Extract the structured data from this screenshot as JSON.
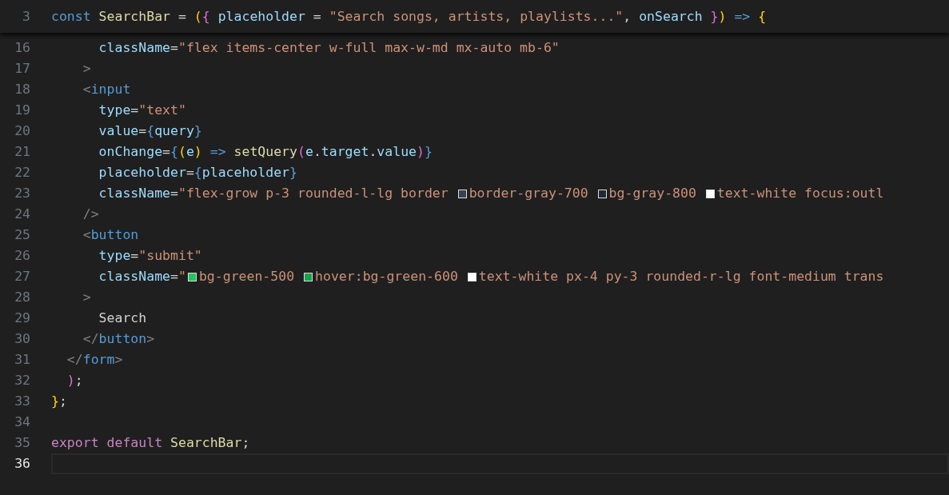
{
  "sticky_line": {
    "number": "3",
    "tokens": [
      {
        "kind": "keyword",
        "text": "const "
      },
      {
        "kind": "function",
        "text": "SearchBar "
      },
      {
        "kind": "punct",
        "text": "= "
      },
      {
        "kind": "bracket1",
        "text": "("
      },
      {
        "kind": "bracket2",
        "text": "{ "
      },
      {
        "kind": "attr",
        "text": "placeholder "
      },
      {
        "kind": "punct",
        "text": "= "
      },
      {
        "kind": "string",
        "text": "\"Search songs, artists, playlists...\""
      },
      {
        "kind": "punct",
        "text": ", "
      },
      {
        "kind": "attr",
        "text": "onSearch "
      },
      {
        "kind": "bracket2",
        "text": "}"
      },
      {
        "kind": "bracket1",
        "text": ")"
      },
      {
        "kind": "keyword",
        "text": " => "
      },
      {
        "kind": "bracket1",
        "text": "{"
      }
    ]
  },
  "lines": [
    {
      "number": "16",
      "current": false,
      "tokens": [
        {
          "kind": "attr",
          "text": "      className"
        },
        {
          "kind": "punct",
          "text": "="
        },
        {
          "kind": "string",
          "text": "\"flex items-center w-full max-w-md mx-auto mb-6\""
        }
      ]
    },
    {
      "number": "17",
      "current": false,
      "tokens": [
        {
          "kind": "tagpunct",
          "text": "    >"
        }
      ]
    },
    {
      "number": "18",
      "current": false,
      "tokens": [
        {
          "kind": "tagpunct",
          "text": "    <"
        },
        {
          "kind": "tag",
          "text": "input"
        }
      ]
    },
    {
      "number": "19",
      "current": false,
      "tokens": [
        {
          "kind": "attr",
          "text": "      type"
        },
        {
          "kind": "punct",
          "text": "="
        },
        {
          "kind": "string",
          "text": "\"text\""
        }
      ]
    },
    {
      "number": "20",
      "current": false,
      "tokens": [
        {
          "kind": "attr",
          "text": "      value"
        },
        {
          "kind": "punct",
          "text": "="
        },
        {
          "kind": "jsx",
          "text": "{"
        },
        {
          "kind": "variable",
          "text": "query"
        },
        {
          "kind": "jsx",
          "text": "}"
        }
      ]
    },
    {
      "number": "21",
      "current": false,
      "tokens": [
        {
          "kind": "attr",
          "text": "      onChange"
        },
        {
          "kind": "punct",
          "text": "="
        },
        {
          "kind": "jsx",
          "text": "{"
        },
        {
          "kind": "bracket1",
          "text": "("
        },
        {
          "kind": "variable",
          "text": "e"
        },
        {
          "kind": "bracket1",
          "text": ")"
        },
        {
          "kind": "keyword",
          "text": " => "
        },
        {
          "kind": "function",
          "text": "setQuery"
        },
        {
          "kind": "bracket2",
          "text": "("
        },
        {
          "kind": "variable",
          "text": "e"
        },
        {
          "kind": "punct",
          "text": "."
        },
        {
          "kind": "variable",
          "text": "target"
        },
        {
          "kind": "punct",
          "text": "."
        },
        {
          "kind": "variable",
          "text": "value"
        },
        {
          "kind": "bracket2",
          "text": ")"
        },
        {
          "kind": "jsx",
          "text": "}"
        }
      ]
    },
    {
      "number": "22",
      "current": false,
      "tokens": [
        {
          "kind": "attr",
          "text": "      placeholder"
        },
        {
          "kind": "punct",
          "text": "="
        },
        {
          "kind": "jsx",
          "text": "{"
        },
        {
          "kind": "variable",
          "text": "placeholder"
        },
        {
          "kind": "jsx",
          "text": "}"
        }
      ]
    },
    {
      "number": "23",
      "current": false,
      "tokens": [
        {
          "kind": "attr",
          "text": "      className"
        },
        {
          "kind": "punct",
          "text": "="
        },
        {
          "kind": "string",
          "text": "\"flex-grow p-3 rounded-l-lg border "
        },
        {
          "kind": "swatch",
          "color": "#374151"
        },
        {
          "kind": "string",
          "text": "border-gray-700 "
        },
        {
          "kind": "swatch",
          "color": "#1f2937"
        },
        {
          "kind": "string",
          "text": "bg-gray-800 "
        },
        {
          "kind": "swatch",
          "color": "#ffffff"
        },
        {
          "kind": "string",
          "text": "text-white focus:outl"
        }
      ]
    },
    {
      "number": "24",
      "current": false,
      "tokens": [
        {
          "kind": "tagpunct",
          "text": "    />"
        }
      ]
    },
    {
      "number": "25",
      "current": false,
      "tokens": [
        {
          "kind": "tagpunct",
          "text": "    <"
        },
        {
          "kind": "tag",
          "text": "button"
        }
      ]
    },
    {
      "number": "26",
      "current": false,
      "tokens": [
        {
          "kind": "attr",
          "text": "      type"
        },
        {
          "kind": "punct",
          "text": "="
        },
        {
          "kind": "string",
          "text": "\"submit\""
        }
      ]
    },
    {
      "number": "27",
      "current": false,
      "tokens": [
        {
          "kind": "attr",
          "text": "      className"
        },
        {
          "kind": "punct",
          "text": "="
        },
        {
          "kind": "string",
          "text": "\""
        },
        {
          "kind": "swatch",
          "color": "#22c55e"
        },
        {
          "kind": "string",
          "text": "bg-green-500 "
        },
        {
          "kind": "swatch",
          "color": "#16a34a"
        },
        {
          "kind": "string",
          "text": "hover:bg-green-600 "
        },
        {
          "kind": "swatch",
          "color": "#ffffff"
        },
        {
          "kind": "string",
          "text": "text-white px-4 py-3 rounded-r-lg font-medium trans"
        }
      ]
    },
    {
      "number": "28",
      "current": false,
      "tokens": [
        {
          "kind": "tagpunct",
          "text": "    >"
        }
      ]
    },
    {
      "number": "29",
      "current": false,
      "tokens": [
        {
          "kind": "text",
          "text": "      Search"
        }
      ]
    },
    {
      "number": "30",
      "current": false,
      "tokens": [
        {
          "kind": "tagpunct",
          "text": "    </"
        },
        {
          "kind": "tag",
          "text": "button"
        },
        {
          "kind": "tagpunct",
          "text": ">"
        }
      ]
    },
    {
      "number": "31",
      "current": false,
      "tokens": [
        {
          "kind": "tagpunct",
          "text": "  </"
        },
        {
          "kind": "tag",
          "text": "form"
        },
        {
          "kind": "tagpunct",
          "text": ">"
        }
      ]
    },
    {
      "number": "32",
      "current": false,
      "tokens": [
        {
          "kind": "bracket2",
          "text": "  )"
        },
        {
          "kind": "punct",
          "text": ";"
        }
      ]
    },
    {
      "number": "33",
      "current": false,
      "tokens": [
        {
          "kind": "bracket1",
          "text": "}"
        },
        {
          "kind": "punct",
          "text": ";"
        }
      ]
    },
    {
      "number": "34",
      "current": false
    },
    {
      "number": "35",
      "current": false,
      "tokens": [
        {
          "kind": "keyword2",
          "text": "export default "
        },
        {
          "kind": "function",
          "text": "SearchBar"
        },
        {
          "kind": "punct",
          "text": ";"
        }
      ]
    },
    {
      "number": "36",
      "current": true
    }
  ]
}
